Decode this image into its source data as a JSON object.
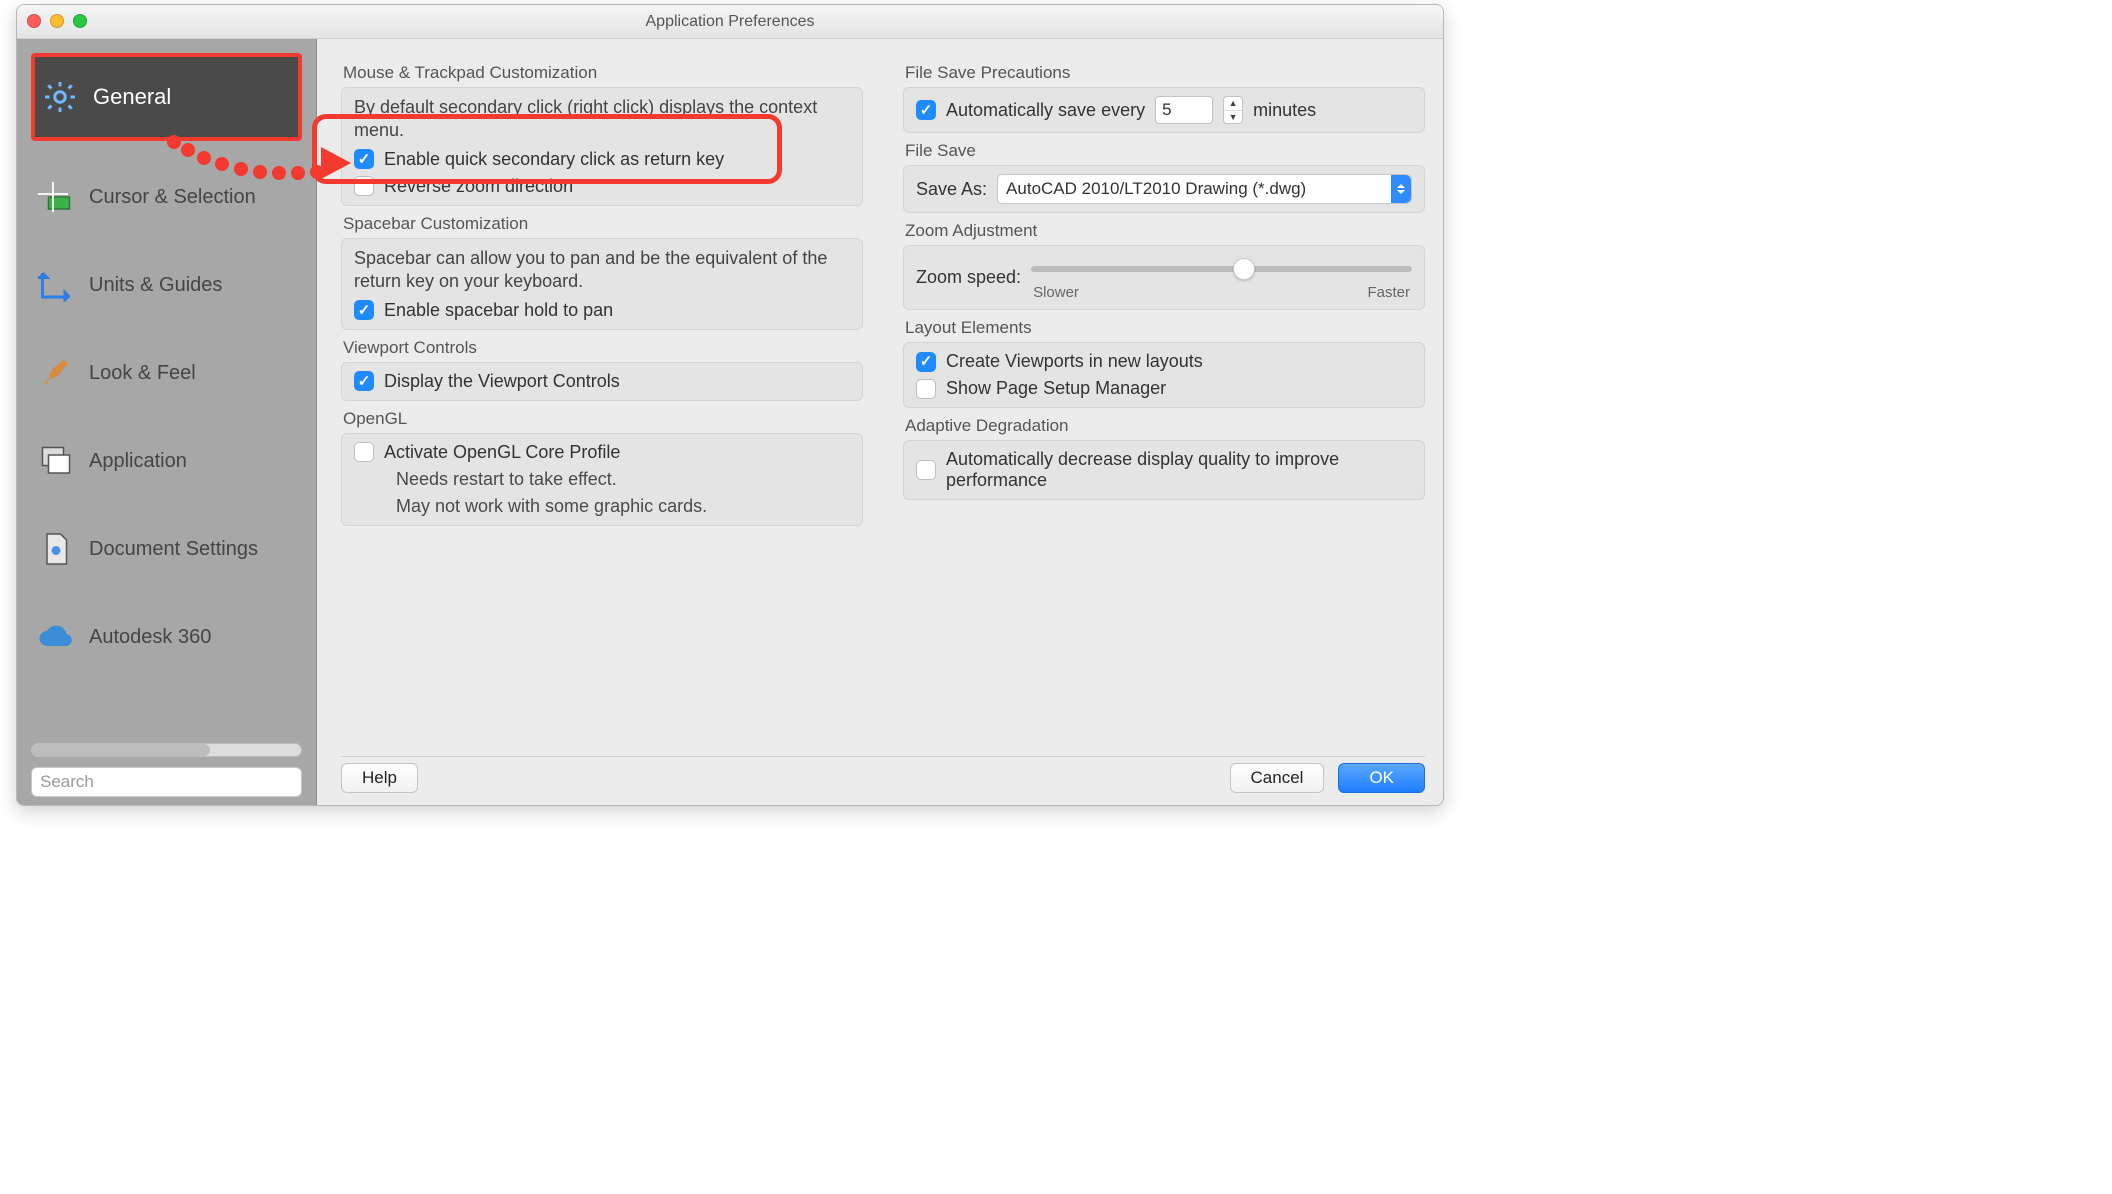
{
  "window": {
    "title": "Application Preferences"
  },
  "sidebar": {
    "items": [
      {
        "label": "General"
      },
      {
        "label": "Cursor & Selection"
      },
      {
        "label": "Units & Guides"
      },
      {
        "label": "Look & Feel"
      },
      {
        "label": "Application"
      },
      {
        "label": "Document Settings"
      },
      {
        "label": "Autodesk 360"
      }
    ],
    "search_placeholder": "Search"
  },
  "left": {
    "mouse": {
      "title": "Mouse & Trackpad Customization",
      "desc": "By default secondary click (right click) displays the context menu.",
      "cb1": "Enable quick secondary click as return key",
      "cb2": "Reverse zoom direction"
    },
    "space": {
      "title": "Spacebar Customization",
      "desc": "Spacebar can allow you to pan and be the equivalent of the return key on your keyboard.",
      "cb1": "Enable spacebar hold to pan"
    },
    "viewport": {
      "title": "Viewport Controls",
      "cb1": "Display the Viewport Controls"
    },
    "opengl": {
      "title": "OpenGL",
      "cb1": "Activate OpenGL Core Profile",
      "hint1": "Needs restart to take effect.",
      "hint2": "May not work with some graphic cards."
    }
  },
  "right": {
    "filesave_prec": {
      "title": "File Save Precautions",
      "cb_label_pre": "Automatically save every",
      "value": "5",
      "unit": "minutes"
    },
    "filesave": {
      "title": "File Save",
      "saveas_label": "Save As:",
      "saveas_value": "AutoCAD 2010/LT2010 Drawing (*.dwg)"
    },
    "zoom": {
      "title": "Zoom Adjustment",
      "label": "Zoom speed:",
      "slow": "Slower",
      "fast": "Faster"
    },
    "layout": {
      "title": "Layout Elements",
      "cb1": "Create Viewports in new layouts",
      "cb2": "Show Page Setup Manager"
    },
    "adaptive": {
      "title": "Adaptive Degradation",
      "cb1": "Automatically decrease display quality to improve performance"
    }
  },
  "buttons": {
    "help": "Help",
    "cancel": "Cancel",
    "ok": "OK"
  }
}
